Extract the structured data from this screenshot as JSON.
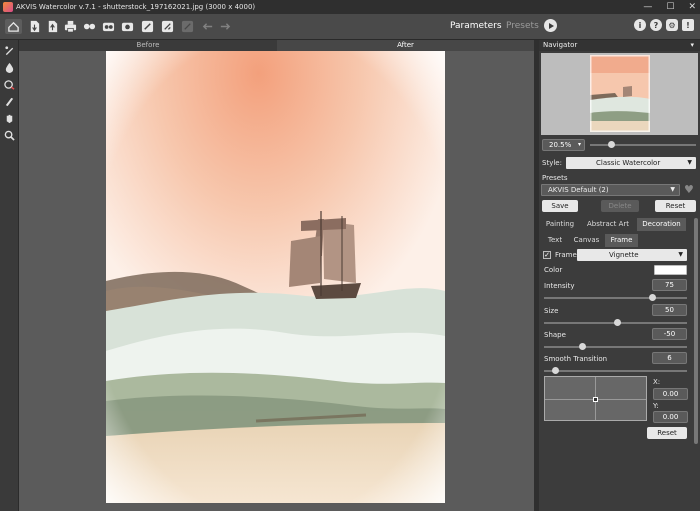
{
  "window": {
    "title": "AKVIS Watercolor v.7.1 - shutterstock_197162021.jpg (3000 x 4000)",
    "controls": [
      "—",
      "☐",
      "✕"
    ]
  },
  "toolbar": {
    "mode_parameters": "Parameters",
    "mode_presets": "Presets",
    "icons": [
      "home-icon",
      "open-file-icon",
      "save-file-icon",
      "print-icon",
      "share-icon",
      "batch-icon",
      "plugin-icon",
      "brush-icon",
      "eraser-icon",
      "crop-icon",
      "undo-icon",
      "redo-icon",
      "run-icon",
      "info-icon",
      "help-icon",
      "settings-icon",
      "news-icon"
    ]
  },
  "view_tabs": {
    "before": "Before",
    "after": "After"
  },
  "navigator": {
    "title": "Navigator",
    "zoom": "20.5%",
    "zoom_fraction": 0.18
  },
  "style": {
    "label": "Style:",
    "value": "Classic Watercolor"
  },
  "presets": {
    "label": "Presets",
    "value": "AKVIS Default (2)",
    "save": "Save",
    "delete": "Delete",
    "reset": "Reset"
  },
  "main_tabs": [
    "Painting",
    "Abstract Art",
    "Decoration"
  ],
  "sub_tabs": [
    "Text",
    "Canvas",
    "Frame"
  ],
  "frame": {
    "checkbox_label": "Frame",
    "checked": true,
    "type": "Vignette",
    "color_label": "Color",
    "color": "#ffffff",
    "params": [
      {
        "label": "Intensity",
        "value": "75",
        "fraction": 0.75
      },
      {
        "label": "Size",
        "value": "50",
        "fraction": 0.5
      },
      {
        "label": "Shape",
        "value": "-50",
        "fraction": 0.25
      },
      {
        "label": "Smooth Transition",
        "value": "6",
        "fraction": 0.06
      }
    ],
    "x_label": "X:",
    "x_value": "0.00",
    "y_label": "Y:",
    "y_value": "0.00",
    "reset": "Reset"
  },
  "colors": {
    "accent": "#e8e8e8",
    "panel": "#3c3c3c",
    "workarea": "#5b5b5b"
  }
}
